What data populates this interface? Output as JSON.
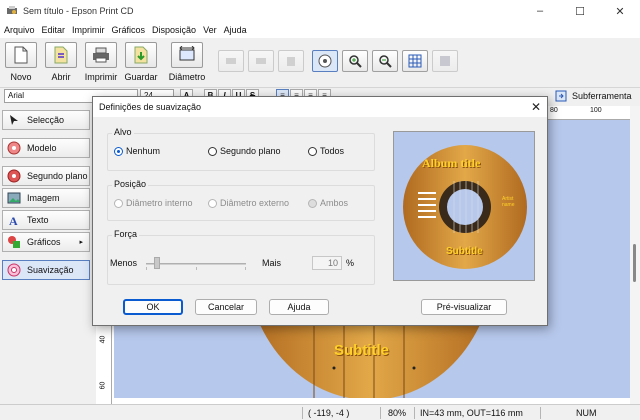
{
  "window": {
    "title": "Sem título - Epson Print CD"
  },
  "menu": [
    "Arquivo",
    "Editar",
    "Imprimir",
    "Gráficos",
    "Disposição",
    "Ver",
    "Ajuda"
  ],
  "toolbar": {
    "novo": "Novo",
    "abrir": "Abrir",
    "imprimir": "Imprimir",
    "guardar": "Guardar",
    "diametro": "Diâmetro"
  },
  "format": {
    "font": "Arial",
    "size": "24",
    "subtool_label": "Subferramenta"
  },
  "left_panel": [
    "Selecção",
    "Modelo",
    "Segundo plano",
    "Imagem",
    "Texto",
    "Gráficos",
    "Suavização"
  ],
  "canvas": {
    "subtitle": "Subtitle",
    "ruler_left": [
      "40",
      "60"
    ],
    "ruler_top": [
      "80",
      "100"
    ]
  },
  "status": {
    "coords": "( -119,  -4 )",
    "zoom": "80%",
    "diam": "IN=43 mm, OUT=116 mm",
    "num": "NUM"
  },
  "dialog": {
    "title": "Definições de suavização",
    "alvo": {
      "title": "Alvo",
      "options": [
        "Nenhum",
        "Segundo plano",
        "Todos"
      ],
      "selected": "Nenhum"
    },
    "posicao": {
      "title": "Posição",
      "options": [
        "Diâmetro interno",
        "Diâmetro externo",
        "Ambos"
      ]
    },
    "forca": {
      "title": "Força",
      "min": "Menos",
      "max": "Mais",
      "value": "10",
      "unit": "%"
    },
    "buttons": {
      "ok": "OK",
      "cancel": "Cancelar",
      "help": "Ajuda",
      "preview": "Pré-visualizar"
    },
    "preview": {
      "album": "Album title",
      "subtitle": "Subtitle",
      "artist": "Artist name"
    }
  },
  "colors": {
    "canvas_bg": "#b6c8ec",
    "disc": "#d89a3c",
    "accent": "#0a5ad0",
    "title_text": "#ffd028"
  }
}
